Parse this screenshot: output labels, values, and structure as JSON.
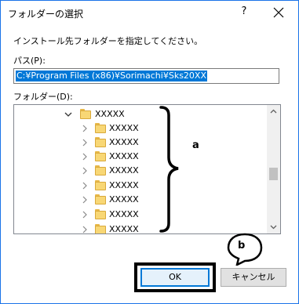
{
  "window": {
    "title": "フォルダーの選択",
    "help_glyph": "?",
    "accent_color": "#1a73e8"
  },
  "dialog": {
    "instruction": "インストール先フォルダーを指定してください。",
    "path_label": "パス(P):",
    "path_value": "C:¥Program Files (x86)¥Sorimachi¥Sks20XX",
    "folder_label": "フォルダー(D):"
  },
  "tree": {
    "root": {
      "label": "XXXXX",
      "expanded": true
    },
    "children": [
      {
        "label": "XXXXX"
      },
      {
        "label": "XXXXX"
      },
      {
        "label": "XXXXX"
      },
      {
        "label": "XXXXX"
      },
      {
        "label": "XXXXX"
      },
      {
        "label": "XXXXX"
      },
      {
        "label": "XXXXX"
      },
      {
        "label": "XXXXX"
      }
    ]
  },
  "annotations": {
    "a": "a",
    "b": "b"
  },
  "buttons": {
    "ok": "OK",
    "cancel": "キャンセル"
  }
}
